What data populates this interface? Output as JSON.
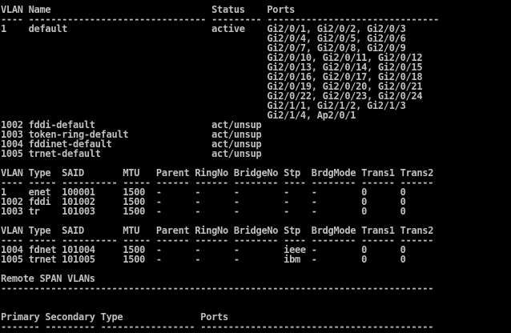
{
  "terminal": {
    "lines": [
      "VLAN Name                             Status    Ports",
      "---- -------------------------------- --------- -------------------------------",
      "1    default                          active    Gi2/0/1, Gi2/0/2, Gi2/0/3",
      "                                                Gi2/0/4, Gi2/0/5, Gi2/0/6",
      "                                                Gi2/0/7, Gi2/0/8, Gi2/0/9",
      "                                                Gi2/0/10, Gi2/0/11, Gi2/0/12",
      "                                                Gi2/0/13, Gi2/0/14, Gi2/0/15",
      "                                                Gi2/0/16, Gi2/0/17, Gi2/0/18",
      "                                                Gi2/0/19, Gi2/0/20, Gi2/0/21",
      "                                                Gi2/0/22, Gi2/0/23, Gi2/0/24",
      "                                                Gi2/1/1, Gi2/1/2, Gi2/1/3",
      "                                                Gi2/1/4, Ap2/0/1",
      "1002 fddi-default                     act/unsup",
      "1003 token-ring-default               act/unsup",
      "1004 fddinet-default                  act/unsup",
      "1005 trnet-default                    act/unsup",
      "",
      "VLAN Type  SAID       MTU   Parent RingNo BridgeNo Stp  BrdgMode Trans1 Trans2",
      "---- ----- ---------- ----- ------ ------ -------- ---- -------- ------ ------",
      "1    enet  100001     1500  -      -      -        -    -        0      0",
      "1002 fddi  101002     1500  -      -      -        -    -        0      0",
      "1003 tr    101003     1500  -      -      -        -    -        0      0",
      "",
      "VLAN Type  SAID       MTU   Parent RingNo BridgeNo Stp  BrdgMode Trans1 Trans2",
      "---- ----- ---------- ----- ------ ------ -------- ---- -------- ------ ------",
      "1004 fdnet 101004     1500  -      -      -        ieee -        0      0",
      "1005 trnet 101005     1500  -      -      -        ibm  -        0      0",
      "",
      "Remote SPAN VLANs",
      "------------------------------------------------------------------------------",
      "",
      "",
      "Primary Secondary Type              Ports",
      "------- --------- ----------------- ------------------------------------------"
    ]
  }
}
